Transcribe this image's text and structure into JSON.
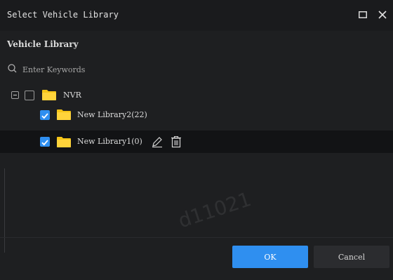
{
  "dialog": {
    "title": "Select Vehicle Library",
    "section_title": "Vehicle Library",
    "watermark": "d11021"
  },
  "search": {
    "placeholder": "Enter Keywords",
    "value": ""
  },
  "tree": {
    "root": {
      "label": "NVR",
      "checked": false,
      "expanded": true
    },
    "children": [
      {
        "label": "New Library2(22)",
        "checked": true
      },
      {
        "label": "New Library1(0)",
        "checked": true
      }
    ]
  },
  "footer": {
    "ok_label": "OK",
    "cancel_label": "Cancel"
  },
  "colors": {
    "accent": "#2f8ff0",
    "folder": "#f5c518",
    "background": "#1e1f21"
  },
  "icons": {
    "search": "search-icon",
    "maximize": "maximize-icon",
    "close": "close-icon",
    "folder": "folder-icon",
    "edit": "pencil-icon",
    "delete": "trash-icon"
  }
}
